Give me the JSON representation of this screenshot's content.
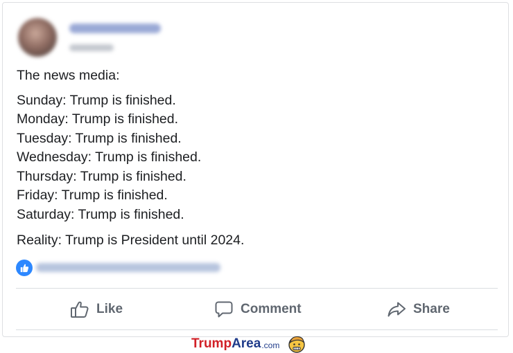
{
  "post": {
    "intro": "The news media:",
    "days": [
      "Sunday: Trump is finished.",
      "Monday: Trump is finished.",
      "Tuesday: Trump is finished.",
      "Wednesday: Trump is finished.",
      "Thursday: Trump is finished.",
      "Friday: Trump is finished.",
      "Saturday: Trump is finished."
    ],
    "reality": "Reality: Trump is President until 2024."
  },
  "actions": {
    "like": "Like",
    "comment": "Comment",
    "share": "Share"
  },
  "icons": {
    "reaction": "thumbs-up-icon",
    "like": "thumbs-up-outline-icon",
    "comment": "speech-bubble-icon",
    "share": "share-arrow-icon",
    "logo": "trump-face-icon"
  },
  "colors": {
    "facebook_blue": "#2d88ff",
    "action_text": "#606770",
    "watermark_red": "#d11f26",
    "watermark_blue": "#1f3b8a"
  },
  "watermark": {
    "part1": "Trump",
    "part2": "Area",
    "part3": ".com"
  }
}
